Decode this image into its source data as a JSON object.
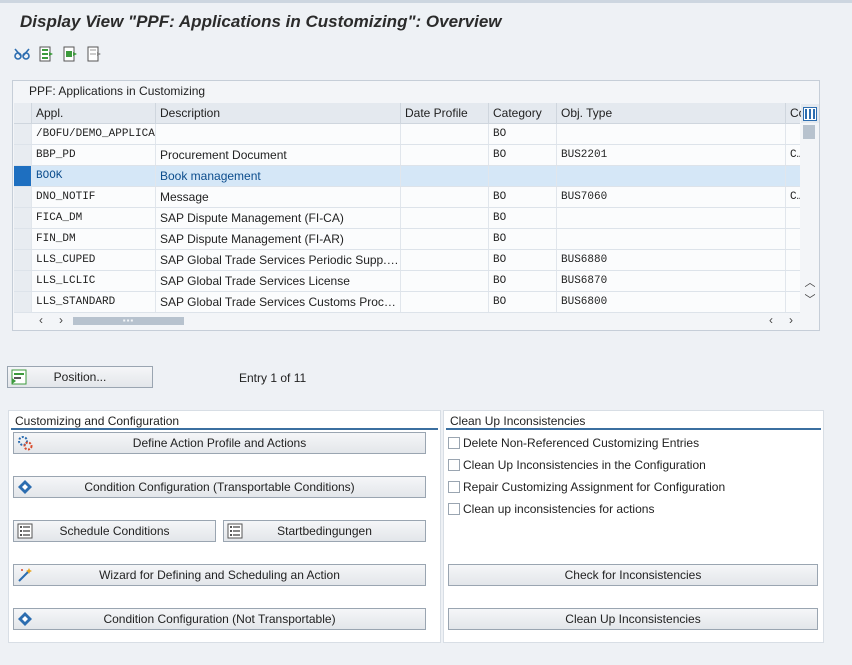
{
  "window": {
    "title": "Display View \"PPF: Applications in Customizing\": Overview"
  },
  "toolbar": {
    "buttons": [
      {
        "icon": "glasses-icon",
        "tooltip": ""
      },
      {
        "icon": "select-all-icon",
        "tooltip": ""
      },
      {
        "icon": "select-block-icon",
        "tooltip": ""
      },
      {
        "icon": "deselect-all-icon",
        "tooltip": ""
      }
    ]
  },
  "table": {
    "title": "PPF: Applications in Customizing",
    "columns": [
      "Appl.",
      "Description",
      "Date Profile",
      "Category",
      "Obj. Type",
      "Co"
    ],
    "rows": [
      {
        "appl": "/BOFU/DEMO_APPLICA",
        "desc": "",
        "date": "",
        "cat": "BO",
        "obj": "",
        "co": ""
      },
      {
        "appl": "BBP_PD",
        "desc": "Procurement Document",
        "date": "",
        "cat": "BO",
        "obj": "BUS2201",
        "co": "CI"
      },
      {
        "appl": "BOOK",
        "desc": "Book management",
        "date": "",
        "cat": "",
        "obj": "",
        "co": ""
      },
      {
        "appl": "DNO_NOTIF",
        "desc": "Message",
        "date": "",
        "cat": "BO",
        "obj": "BUS7060",
        "co": "CI"
      },
      {
        "appl": "FICA_DM",
        "desc": "SAP Dispute Management (FI-CA)",
        "date": "",
        "cat": "BO",
        "obj": "",
        "co": ""
      },
      {
        "appl": "FIN_DM",
        "desc": "SAP Dispute Management (FI-AR)",
        "date": "",
        "cat": "BO",
        "obj": "",
        "co": ""
      },
      {
        "appl": "LLS_CUPED",
        "desc": "SAP Global Trade Services Periodic Supp. C...",
        "date": "",
        "cat": "BO",
        "obj": "BUS6880",
        "co": ""
      },
      {
        "appl": "LLS_LCLIC",
        "desc": "SAP Global Trade Services License",
        "date": "",
        "cat": "BO",
        "obj": "BUS6870",
        "co": ""
      },
      {
        "appl": "LLS_STANDARD",
        "desc": "SAP Global Trade Services Customs Proces...",
        "date": "",
        "cat": "BO",
        "obj": "BUS6800",
        "co": ""
      }
    ],
    "selected_index": 2,
    "hscroll_thumb": "▪▪▪"
  },
  "position": {
    "button_label": "Position...",
    "entry_info": "Entry 1 of 11"
  },
  "customizing": {
    "title": "Customizing and Configuration",
    "define_action_profile": "Define Action Profile and Actions",
    "condition_config_transportable": "Condition Configuration (Transportable Conditions)",
    "schedule_conditions": "Schedule Conditions",
    "startbedingungen": "Startbedingungen",
    "wizard": "Wizard for Defining and Scheduling an Action",
    "condition_config_not_transportable": "Condition Configuration (Not Transportable)"
  },
  "cleanup": {
    "title": "Clean Up Inconsistencies",
    "checkboxes": [
      {
        "label": "Delete Non-Referenced Customizing Entries",
        "checked": false
      },
      {
        "label": "Clean Up Inconsistencies in the Configuration",
        "checked": false
      },
      {
        "label": "Repair Customizing Assignment for Configuration",
        "checked": false
      },
      {
        "label": "Clean up inconsistencies for actions",
        "checked": false
      }
    ],
    "check_button": "Check for Inconsistencies",
    "cleanup_button": "Clean Up Inconsistencies"
  },
  "colors": {
    "selection": "#d5e7f7",
    "selection_marker": "#1e6fc0",
    "group_line": "#3b6fa0"
  }
}
